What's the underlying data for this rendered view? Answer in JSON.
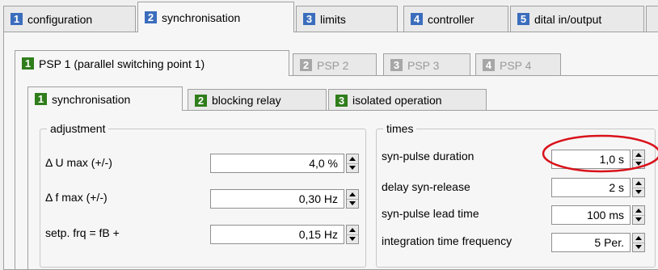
{
  "top_tabs": [
    {
      "num": "1",
      "label": "configuration"
    },
    {
      "num": "2",
      "label": "synchronisation"
    },
    {
      "num": "3",
      "label": "limits"
    },
    {
      "num": "4",
      "label": "controller"
    },
    {
      "num": "5",
      "label": "dital in/output"
    }
  ],
  "psp_tabs": [
    {
      "num": "1",
      "label": "PSP 1 (parallel switching point 1)"
    },
    {
      "num": "2",
      "label": "PSP 2"
    },
    {
      "num": "3",
      "label": "PSP 3"
    },
    {
      "num": "4",
      "label": "PSP 4"
    }
  ],
  "sub_tabs": [
    {
      "num": "1",
      "label": "synchronisation"
    },
    {
      "num": "2",
      "label": "blocking relay"
    },
    {
      "num": "3",
      "label": "isolated operation"
    }
  ],
  "adjustment": {
    "legend": "adjustment",
    "rows": [
      {
        "label": "Δ U max (+/-)",
        "value": "4,0 %"
      },
      {
        "label": "Δ f max (+/-)",
        "value": "0,30 Hz"
      },
      {
        "label": "setp. frq = fB +",
        "value": "0,15 Hz"
      }
    ]
  },
  "times": {
    "legend": "times",
    "rows": [
      {
        "label": "syn-pulse duration",
        "value": "1,0 s"
      },
      {
        "label": "delay syn-release",
        "value": "2 s"
      },
      {
        "label": "syn-pulse lead time",
        "value": "100 ms"
      },
      {
        "label": "integration time frequency",
        "value": "5 Per."
      }
    ]
  },
  "colors": {
    "tab_number_blue": "#3b6dbd",
    "tab_number_gray": "#a7a7a7",
    "tab_number_green": "#2f7d1b",
    "highlight_ellipse": "#d9121b"
  }
}
